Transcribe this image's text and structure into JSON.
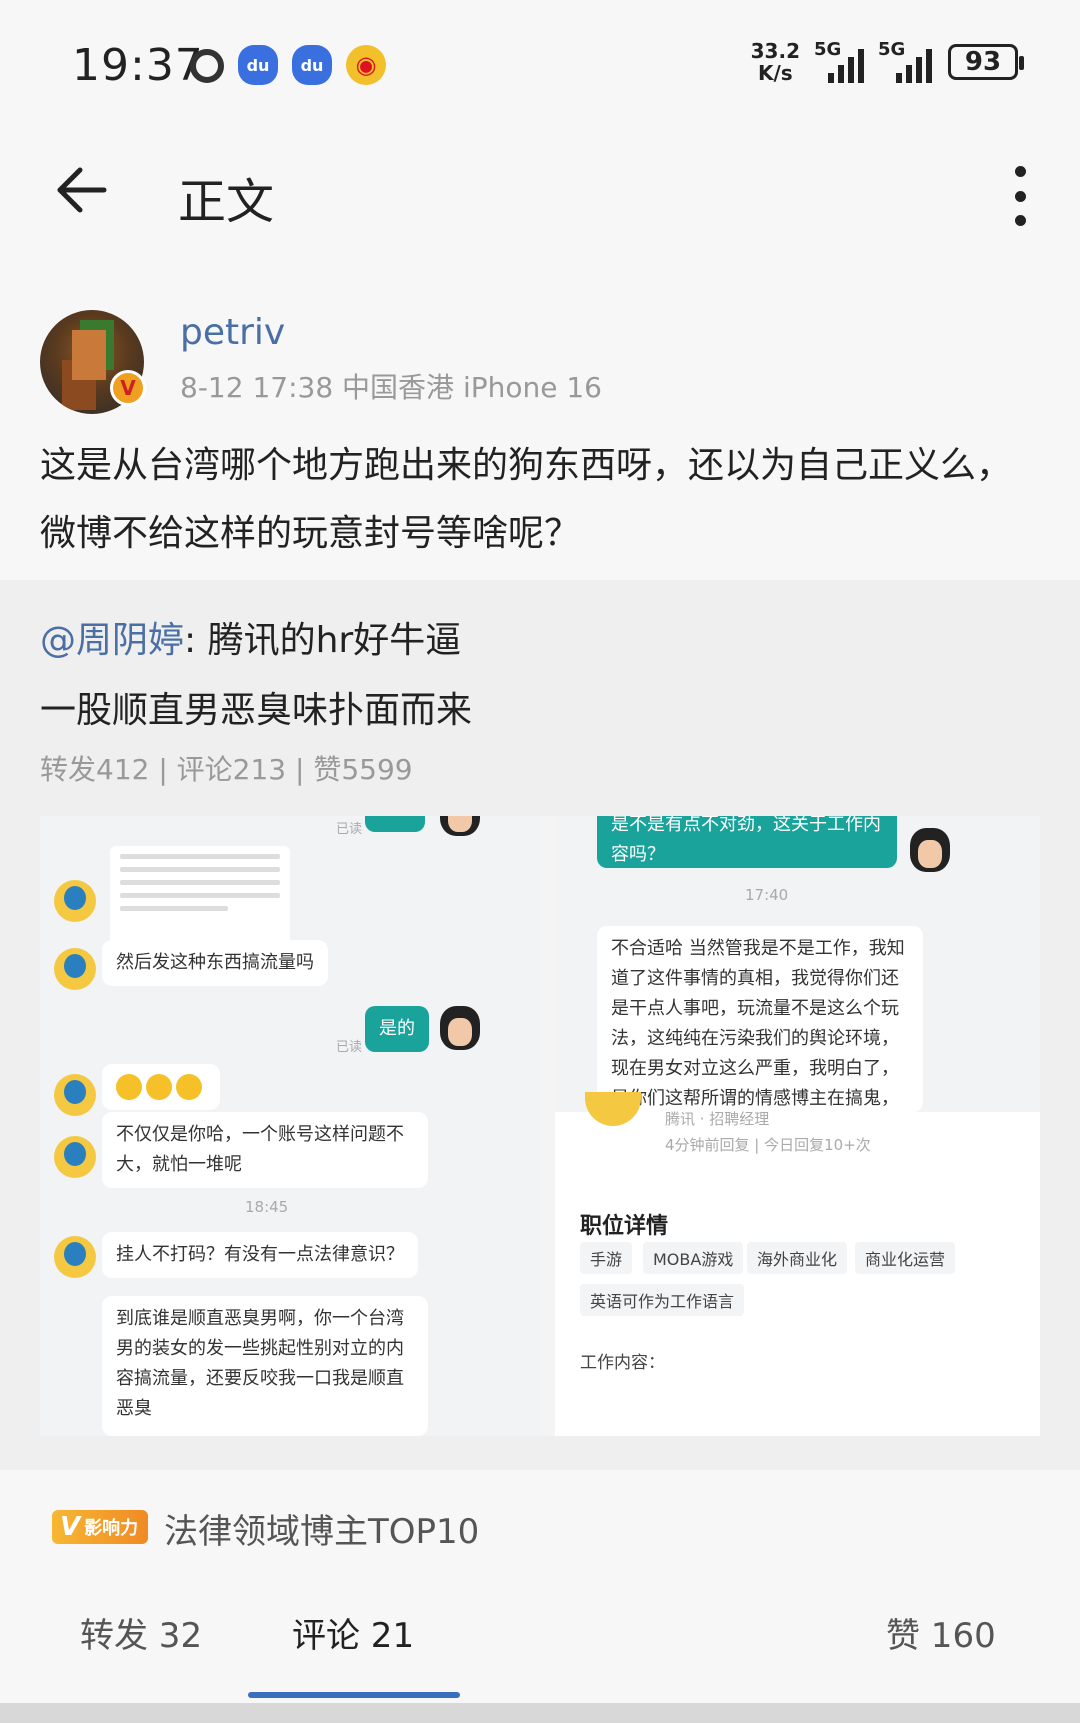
{
  "status_bar": {
    "time": "19:37",
    "net_speed_value": "33.2",
    "net_speed_unit": "K/s",
    "sim1": "5G",
    "sim2": "5G",
    "battery": "93"
  },
  "nav": {
    "title": "正文"
  },
  "post": {
    "username": "petriv",
    "meta": "8-12 17:38 中国香港 iPhone 16",
    "text": "这是从台湾哪个地方跑出来的狗东西呀，还以为自己正义么，微博不给这样的玩意封号等啥呢？"
  },
  "repost": {
    "mention": "@周阴婷",
    "text_line1": ": 腾讯的hr好牛逼",
    "text_line2": "一股顺直男恶臭味扑面而来",
    "stats": "转发412 | 评论213 | 赞5599",
    "screenshot": {
      "left_chat": {
        "read1": "已读",
        "msg1": "然后发这种东西搞流量吗",
        "msg_yes": "是的",
        "read2": "已读",
        "msg3": "不仅仅是你哈，一个账号这样问题不大，就怕一堆呢",
        "time": "18:45",
        "msg4": "挂人不打码？有没有一点法律意识？",
        "msg5": "到底谁是顺直恶臭男啊，你一个台湾男的装女的发一些挑起性别对立的内容搞流量，还要反咬我一口我是顺直恶臭"
      },
      "right_chat": {
        "top_msg": "是不是有点不对劲，这关于工作内容吗？",
        "time": "17:40",
        "msg_long": "不合适哈 当然管我是不是工作，我知道了这件事情的真相，我觉得你们还是干点人事吧，玩流量不是这么个玩法，这纯纯在污染我们的舆论环境，现在男女对立这么严重，我明白了，是你们这帮所谓的情感博主在搞鬼，甚至都"
      },
      "job_card": {
        "head": "腾讯 · 招聘经理",
        "reply_info": "4分钟前回复 | 今日回复10+次",
        "title": "职位详情",
        "tags": [
          "手游",
          "MOBA游戏",
          "海外商业化",
          "商业化运营",
          "英语可作为工作语言"
        ],
        "desc_label": "工作内容："
      }
    }
  },
  "influence": {
    "badge_letter": "V",
    "badge_text": "影响力",
    "text": "法律领域博主TOP10"
  },
  "tabs": {
    "repost": "转发 32",
    "comment": "评论 21",
    "like": "赞 160"
  },
  "colors": {
    "link_blue": "#4a6fa5",
    "tab_indicator": "#3a6fc0",
    "chat_green": "#1aa39b"
  }
}
